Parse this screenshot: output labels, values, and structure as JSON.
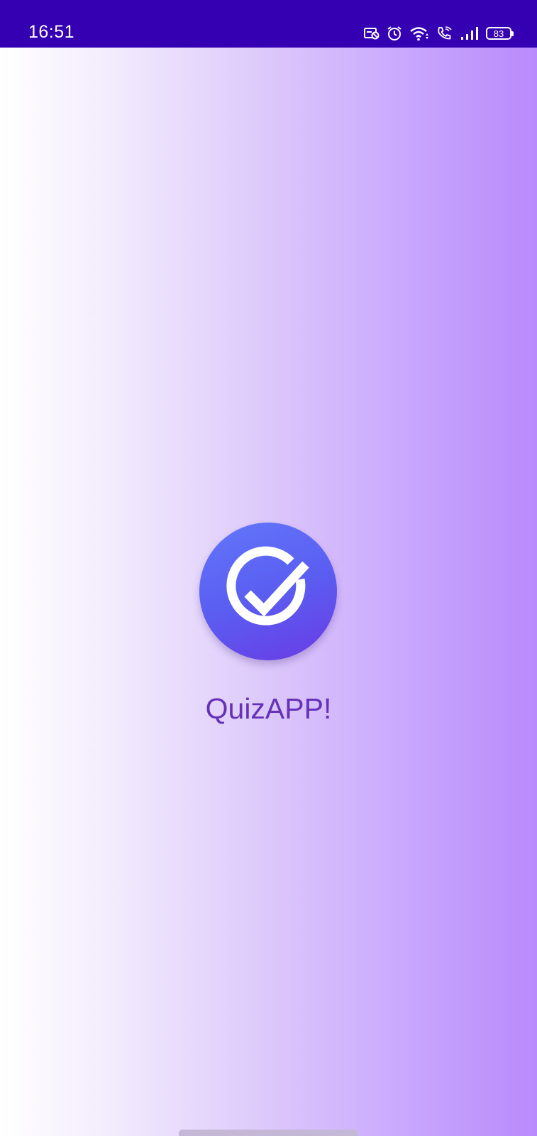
{
  "status_bar": {
    "time": "16:51",
    "battery_level": "83",
    "icons": [
      "notification-icon",
      "alarm-icon",
      "wifi-icon",
      "wifi-call-icon",
      "signal-icon",
      "battery-icon"
    ],
    "background_color": "#3500b2"
  },
  "splash": {
    "app_name": "QuizAPP!",
    "logo_icon": "check-circle-icon",
    "accent_color": "#6532b8"
  }
}
